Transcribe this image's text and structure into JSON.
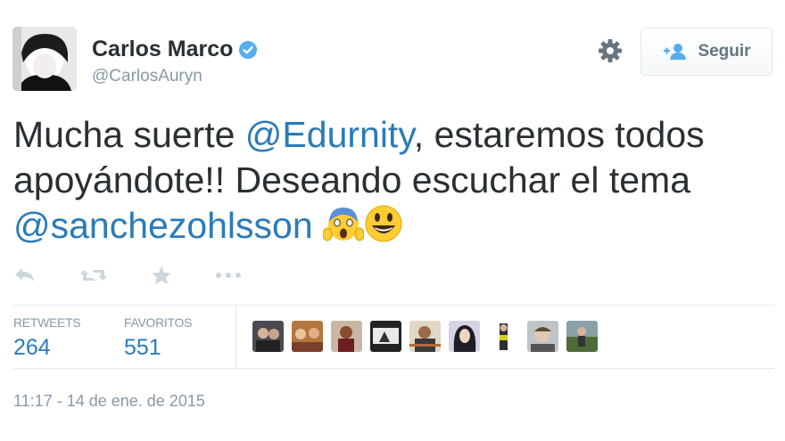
{
  "user": {
    "name": "Carlos Marco",
    "handle": "@CarlosAuryn"
  },
  "follow_button": {
    "label": "Seguir"
  },
  "tweet": {
    "text_part1": "Mucha suerte ",
    "mention1": "@Edurnity",
    "text_part2": ", estaremos todos apoyándote!! Deseando escuchar el tema ",
    "mention2": "@sanchezohlsson",
    "emojis": [
      "face-screaming-in-fear-icon",
      "smiley-icon"
    ]
  },
  "stats": {
    "retweets_label": "RETWEETS",
    "retweets_value": "264",
    "favorites_label": "FAVORITOS",
    "favorites_value": "551"
  },
  "timestamp": "11:17 - 14 de ene. de 2015",
  "colors": {
    "link": "#2b7bb9",
    "muted": "#8899a6",
    "verified": "#55acee"
  },
  "favoriter_avatars": 9
}
